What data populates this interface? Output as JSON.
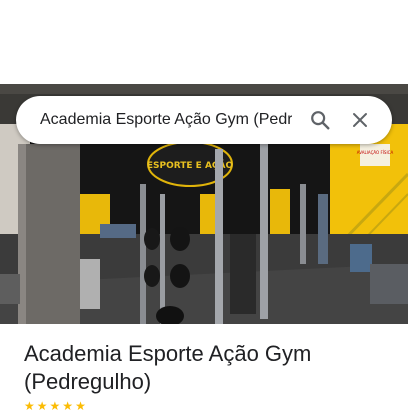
{
  "search": {
    "query": "Academia Esporte Ação Gym (Pedregulho)"
  },
  "place": {
    "title_line1": "Academia Esporte Ação Gym",
    "title_line2": "(Pedregulho)"
  },
  "photo": {
    "logo_text": "ESPORTE E AÇÃO",
    "sign_text": "AVALIAÇÃO FÍSICA"
  },
  "icons": {
    "search": "search-icon",
    "close": "close-icon"
  },
  "colors": {
    "accent_yellow": "#f2c10a",
    "wall_dark": "#151515",
    "star": "#fbbc04"
  }
}
